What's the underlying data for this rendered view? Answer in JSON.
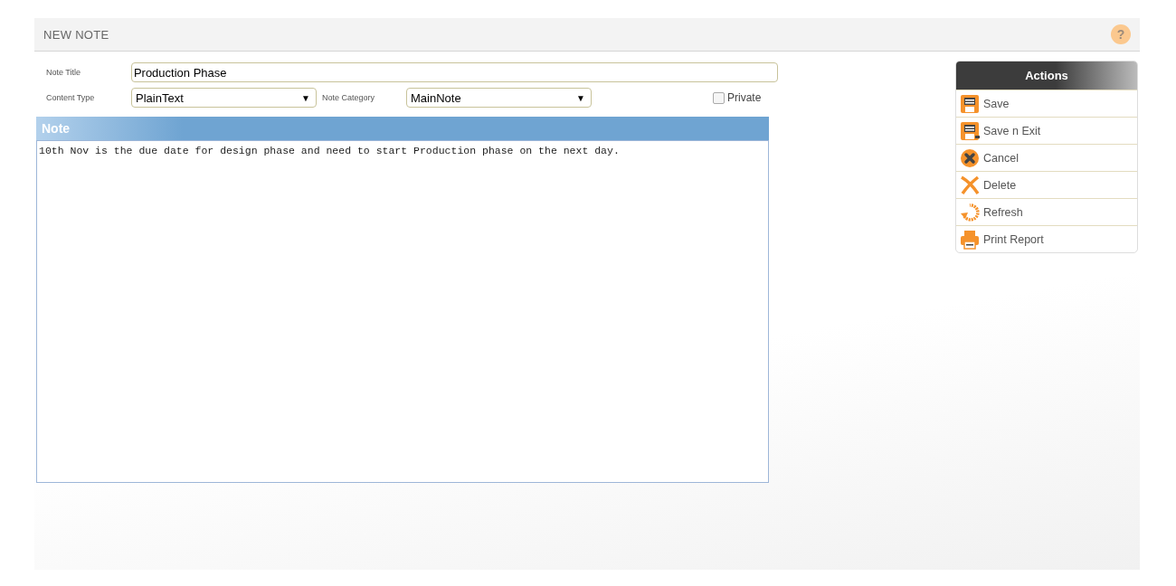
{
  "header": {
    "title": "NEW NOTE",
    "help": "?"
  },
  "form": {
    "note_title": {
      "label": "Note Title",
      "value": "Production Phase"
    },
    "content_type": {
      "label": "Content Type",
      "value": "PlainText",
      "arrow": "▼"
    },
    "note_category": {
      "label": "Note Category",
      "value": "MainNote",
      "arrow": "▼"
    },
    "private": {
      "label": "Private",
      "checked": false
    }
  },
  "note": {
    "heading": "Note",
    "text": "10th Nov is the due date for design phase and need to start Production phase on the next day."
  },
  "actions": {
    "title": "Actions",
    "items": [
      {
        "label": "Save",
        "kind": "save"
      },
      {
        "label": "Save n Exit",
        "kind": "save-exit"
      },
      {
        "label": "Cancel",
        "kind": "cancel"
      },
      {
        "label": "Delete",
        "kind": "delete"
      },
      {
        "label": "Refresh",
        "kind": "refresh"
      },
      {
        "label": "Print Report",
        "kind": "print"
      }
    ]
  }
}
